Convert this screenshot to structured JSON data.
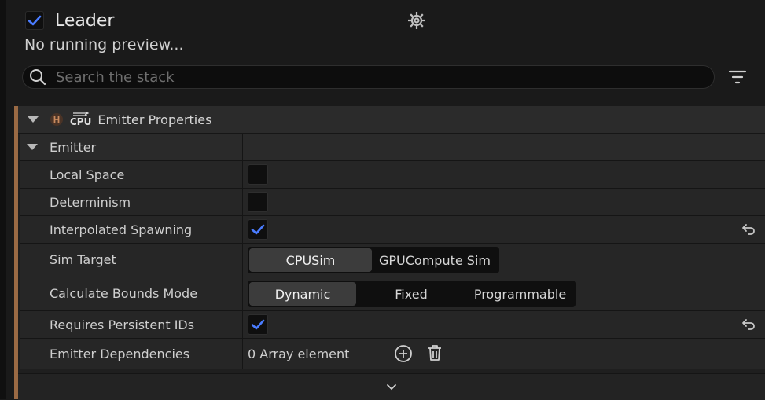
{
  "header": {
    "title": "Leader",
    "enabled": true,
    "preview_status": "No running preview..."
  },
  "search": {
    "placeholder": "Search the stack",
    "value": ""
  },
  "section": {
    "title": "Emitter Properties",
    "badge": "CPU",
    "category": "Emitter"
  },
  "properties": [
    {
      "label": "Local Space",
      "type": "checkbox",
      "checked": false
    },
    {
      "label": "Determinism",
      "type": "checkbox",
      "checked": false
    },
    {
      "label": "Interpolated Spawning",
      "type": "checkbox",
      "checked": true,
      "resettable": true
    },
    {
      "label": "Sim Target",
      "type": "segmented",
      "options": [
        "CPUSim",
        "GPUCompute Sim"
      ],
      "selected": "CPUSim"
    },
    {
      "label": "Calculate Bounds Mode",
      "type": "segmented",
      "options": [
        "Dynamic",
        "Fixed",
        "Programmable"
      ],
      "selected": "Dynamic"
    },
    {
      "label": "Requires Persistent IDs",
      "type": "checkbox",
      "checked": true,
      "resettable": true
    },
    {
      "label": "Emitter Dependencies",
      "type": "array",
      "value": "0 Array element"
    }
  ],
  "colors": {
    "accent": "#9a6a44",
    "check": "#4a7cff"
  },
  "icons": [
    "gear-icon",
    "search-icon",
    "filter-icon",
    "chevron-down-icon",
    "reset-icon",
    "add-icon",
    "trash-icon"
  ]
}
